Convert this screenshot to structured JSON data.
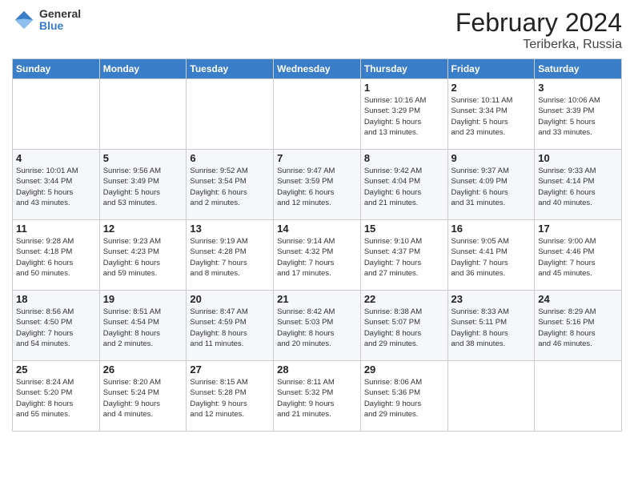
{
  "logo": {
    "general": "General",
    "blue": "Blue"
  },
  "header": {
    "month_year": "February 2024",
    "location": "Teriberka, Russia"
  },
  "weekdays": [
    "Sunday",
    "Monday",
    "Tuesday",
    "Wednesday",
    "Thursday",
    "Friday",
    "Saturday"
  ],
  "weeks": [
    [
      {
        "day": "",
        "info": ""
      },
      {
        "day": "",
        "info": ""
      },
      {
        "day": "",
        "info": ""
      },
      {
        "day": "",
        "info": ""
      },
      {
        "day": "1",
        "info": "Sunrise: 10:16 AM\nSunset: 3:29 PM\nDaylight: 5 hours\nand 13 minutes."
      },
      {
        "day": "2",
        "info": "Sunrise: 10:11 AM\nSunset: 3:34 PM\nDaylight: 5 hours\nand 23 minutes."
      },
      {
        "day": "3",
        "info": "Sunrise: 10:06 AM\nSunset: 3:39 PM\nDaylight: 5 hours\nand 33 minutes."
      }
    ],
    [
      {
        "day": "4",
        "info": "Sunrise: 10:01 AM\nSunset: 3:44 PM\nDaylight: 5 hours\nand 43 minutes."
      },
      {
        "day": "5",
        "info": "Sunrise: 9:56 AM\nSunset: 3:49 PM\nDaylight: 5 hours\nand 53 minutes."
      },
      {
        "day": "6",
        "info": "Sunrise: 9:52 AM\nSunset: 3:54 PM\nDaylight: 6 hours\nand 2 minutes."
      },
      {
        "day": "7",
        "info": "Sunrise: 9:47 AM\nSunset: 3:59 PM\nDaylight: 6 hours\nand 12 minutes."
      },
      {
        "day": "8",
        "info": "Sunrise: 9:42 AM\nSunset: 4:04 PM\nDaylight: 6 hours\nand 21 minutes."
      },
      {
        "day": "9",
        "info": "Sunrise: 9:37 AM\nSunset: 4:09 PM\nDaylight: 6 hours\nand 31 minutes."
      },
      {
        "day": "10",
        "info": "Sunrise: 9:33 AM\nSunset: 4:14 PM\nDaylight: 6 hours\nand 40 minutes."
      }
    ],
    [
      {
        "day": "11",
        "info": "Sunrise: 9:28 AM\nSunset: 4:18 PM\nDaylight: 6 hours\nand 50 minutes."
      },
      {
        "day": "12",
        "info": "Sunrise: 9:23 AM\nSunset: 4:23 PM\nDaylight: 6 hours\nand 59 minutes."
      },
      {
        "day": "13",
        "info": "Sunrise: 9:19 AM\nSunset: 4:28 PM\nDaylight: 7 hours\nand 8 minutes."
      },
      {
        "day": "14",
        "info": "Sunrise: 9:14 AM\nSunset: 4:32 PM\nDaylight: 7 hours\nand 17 minutes."
      },
      {
        "day": "15",
        "info": "Sunrise: 9:10 AM\nSunset: 4:37 PM\nDaylight: 7 hours\nand 27 minutes."
      },
      {
        "day": "16",
        "info": "Sunrise: 9:05 AM\nSunset: 4:41 PM\nDaylight: 7 hours\nand 36 minutes."
      },
      {
        "day": "17",
        "info": "Sunrise: 9:00 AM\nSunset: 4:46 PM\nDaylight: 7 hours\nand 45 minutes."
      }
    ],
    [
      {
        "day": "18",
        "info": "Sunrise: 8:56 AM\nSunset: 4:50 PM\nDaylight: 7 hours\nand 54 minutes."
      },
      {
        "day": "19",
        "info": "Sunrise: 8:51 AM\nSunset: 4:54 PM\nDaylight: 8 hours\nand 2 minutes."
      },
      {
        "day": "20",
        "info": "Sunrise: 8:47 AM\nSunset: 4:59 PM\nDaylight: 8 hours\nand 11 minutes."
      },
      {
        "day": "21",
        "info": "Sunrise: 8:42 AM\nSunset: 5:03 PM\nDaylight: 8 hours\nand 20 minutes."
      },
      {
        "day": "22",
        "info": "Sunrise: 8:38 AM\nSunset: 5:07 PM\nDaylight: 8 hours\nand 29 minutes."
      },
      {
        "day": "23",
        "info": "Sunrise: 8:33 AM\nSunset: 5:11 PM\nDaylight: 8 hours\nand 38 minutes."
      },
      {
        "day": "24",
        "info": "Sunrise: 8:29 AM\nSunset: 5:16 PM\nDaylight: 8 hours\nand 46 minutes."
      }
    ],
    [
      {
        "day": "25",
        "info": "Sunrise: 8:24 AM\nSunset: 5:20 PM\nDaylight: 8 hours\nand 55 minutes."
      },
      {
        "day": "26",
        "info": "Sunrise: 8:20 AM\nSunset: 5:24 PM\nDaylight: 9 hours\nand 4 minutes."
      },
      {
        "day": "27",
        "info": "Sunrise: 8:15 AM\nSunset: 5:28 PM\nDaylight: 9 hours\nand 12 minutes."
      },
      {
        "day": "28",
        "info": "Sunrise: 8:11 AM\nSunset: 5:32 PM\nDaylight: 9 hours\nand 21 minutes."
      },
      {
        "day": "29",
        "info": "Sunrise: 8:06 AM\nSunset: 5:36 PM\nDaylight: 9 hours\nand 29 minutes."
      },
      {
        "day": "",
        "info": ""
      },
      {
        "day": "",
        "info": ""
      }
    ]
  ]
}
